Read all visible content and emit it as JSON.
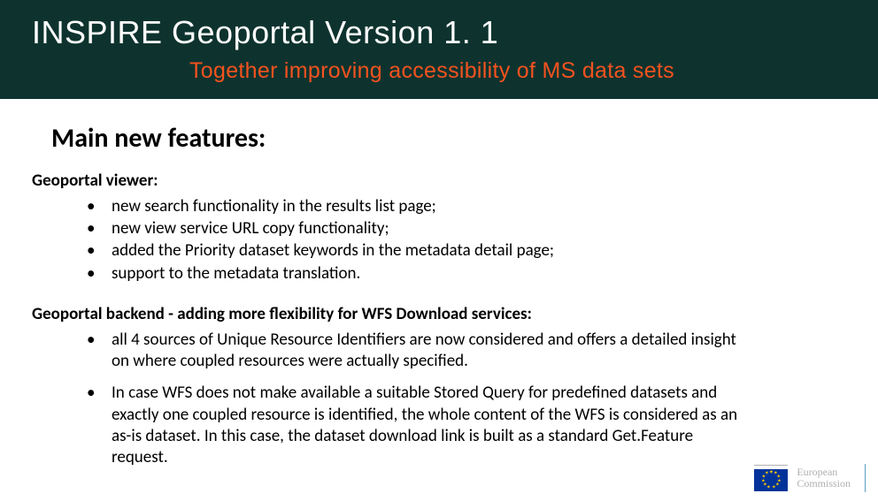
{
  "header": {
    "title": "INSPIRE Geoportal Version 1. 1",
    "subtitle": "Together improving accessibility of MS data sets"
  },
  "main": {
    "heading": "Main new features:",
    "groups": [
      {
        "title": "Geoportal viewer:",
        "items": [
          "new search functionality in the results list page;",
          "new view service URL copy functionality;",
          "added the Priority dataset keywords in the metadata detail page;",
          "support to the metadata translation."
        ]
      },
      {
        "title": "Geoportal backend - adding more flexibility for WFS Download services:",
        "items": [
          "all 4 sources of Unique Resource Identifiers are now considered and offers a detailed insight on where coupled resources were actually specified.",
          "In case WFS does not make available a suitable Stored Query for predefined datasets and exactly one coupled resource is identified, the whole content of the WFS is considered as an as-is dataset. In this case, the dataset download link is built as a standard Get.Feature request."
        ]
      }
    ]
  },
  "footer": {
    "org1": "European",
    "org2": "Commission"
  }
}
